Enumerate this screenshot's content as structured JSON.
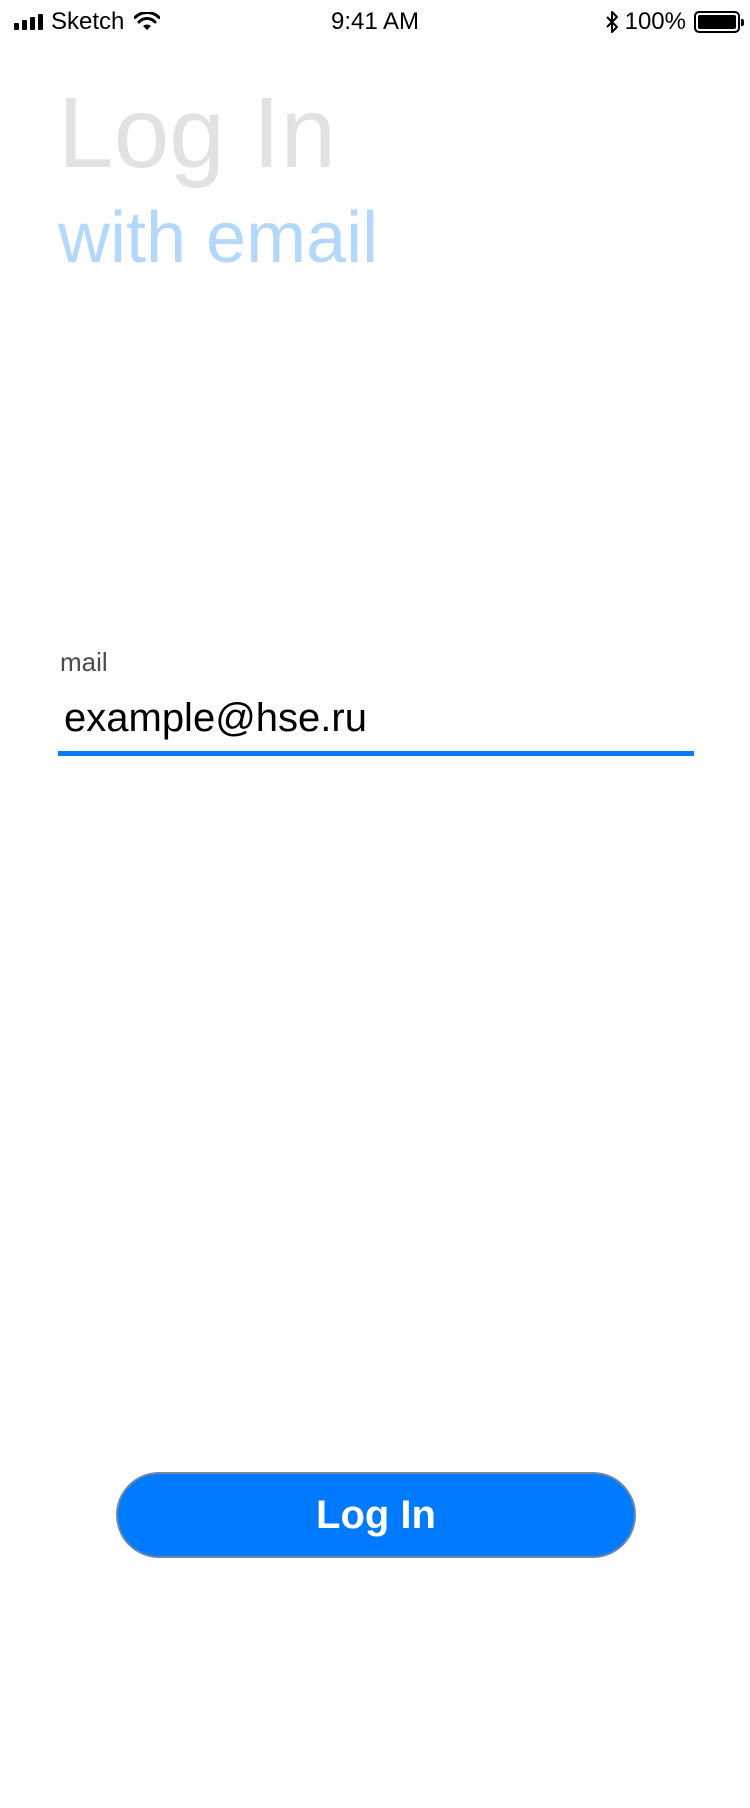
{
  "status_bar": {
    "carrier": "Sketch",
    "time": "9:41 AM",
    "battery_percent": "100%",
    "icons": [
      "signal-icon",
      "wifi-icon",
      "bluetooth-icon",
      "battery-icon"
    ]
  },
  "header": {
    "title": "Log In",
    "subtitle": "with email"
  },
  "form": {
    "email": {
      "label": "mail",
      "value": "example@hse.ru"
    }
  },
  "actions": {
    "login_label": "Log In"
  },
  "colors": {
    "accent": "#007aff",
    "title": "#e2e2e2",
    "subtitle": "#b4d8fb",
    "underline": "#0a7bff"
  }
}
